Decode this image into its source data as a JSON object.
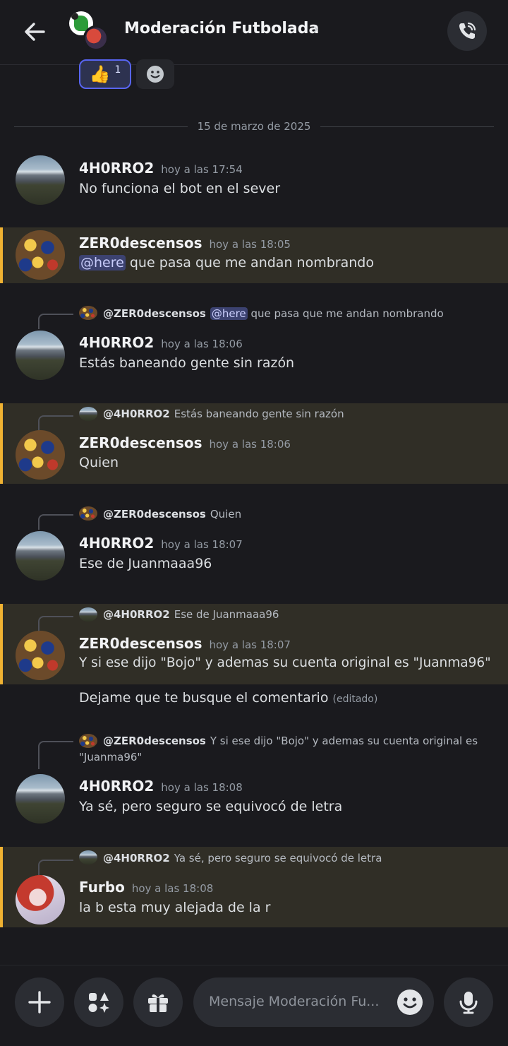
{
  "header": {
    "title": "Moderación Futbolada",
    "chevron": "›"
  },
  "reactions": [
    {
      "emoji": "👍",
      "count": "1"
    }
  ],
  "date_divider": "15 de marzo de 2025",
  "messages": [
    {
      "user": "4H0RRO2",
      "time": "hoy a las 17:54",
      "text": "No funciona el bot en el sever"
    },
    {
      "user": "ZER0descensos",
      "time": "hoy a las 18:05",
      "mention": "@here",
      "text": " que pasa que me andan nombrando"
    },
    {
      "reply_user": "@ZER0descensos",
      "reply_mention": "@here",
      "reply_text": " que pasa que me andan nombrando",
      "user": "4H0RRO2",
      "time": "hoy a las 18:06",
      "text": "Estás baneando gente sin razón"
    },
    {
      "reply_user": "@4H0RRO2",
      "reply_text": "Estás baneando gente sin razón",
      "user": "ZER0descensos",
      "time": "hoy a las 18:06",
      "text": "Quien"
    },
    {
      "reply_user": "@ZER0descensos",
      "reply_text": "Quien",
      "user": "4H0RRO2",
      "time": "hoy a las 18:07",
      "text": "Ese de Juanmaaa96"
    },
    {
      "reply_user": "@4H0RRO2",
      "reply_text": "Ese de Juanmaaa96",
      "user": "ZER0descensos",
      "time": "hoy a las 18:07",
      "text": "Y si ese dijo \"Bojo\" y ademas su cuenta original es \"Juanma96\"",
      "followup": "Dejame que te busque el comentario",
      "edited": "(editado)"
    },
    {
      "reply_user": "@ZER0descensos",
      "reply_text": "Y si ese dijo \"Bojo\" y ademas su cuenta original es",
      "reply_text_2": "\"Juanma96\"",
      "user": "4H0RRO2",
      "time": "hoy a las 18:08",
      "text": "Ya sé, pero seguro se equivocó de letra"
    },
    {
      "reply_user": "@4H0RRO2",
      "reply_text": "Ya sé, pero seguro se equivocó de letra",
      "user": "Furbo",
      "time": "hoy a las 18:08",
      "text": "la b esta muy alejada de la r"
    }
  ],
  "composer": {
    "placeholder": "Mensaje Moderación Fu..."
  },
  "colors": {
    "background": "#1a1a1e",
    "highlight": "#302e26",
    "highlight_bar": "#f0b232",
    "mention": "#3c4270",
    "accent": "#5865f2"
  },
  "icons": [
    "back-arrow-icon",
    "chevron-right-icon",
    "phone-call-icon",
    "thumbs-up-emoji",
    "add-reaction-icon",
    "plus-icon",
    "apps-icon",
    "gift-icon",
    "emoji-icon",
    "microphone-icon"
  ]
}
